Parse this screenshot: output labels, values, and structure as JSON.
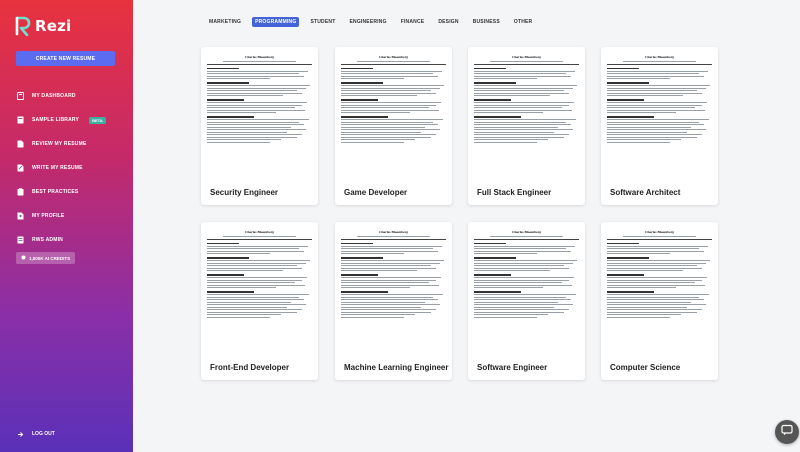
{
  "app": {
    "name": "Rezi"
  },
  "sidebar": {
    "create_button": "CREATE NEW RESUME",
    "items": [
      {
        "label": "MY DASHBOARD",
        "icon": "home-icon"
      },
      {
        "label": "SAMPLE LIBRARY",
        "icon": "book-icon",
        "badge": "BETA"
      },
      {
        "label": "REVIEW MY RESUME",
        "icon": "document-check-icon"
      },
      {
        "label": "WRITE MY RESUME",
        "icon": "pencil-icon"
      },
      {
        "label": "BEST PRACTICES",
        "icon": "clipboard-icon"
      },
      {
        "label": "MY PROFILE",
        "icon": "user-icon"
      },
      {
        "label": "RWS ADMIN",
        "icon": "admin-icon"
      }
    ],
    "credits": "1,500K AI CREDITS",
    "logout": "LOG OUT"
  },
  "filters": [
    {
      "label": "MARKETING",
      "active": false
    },
    {
      "label": "PROGRAMMING",
      "active": true
    },
    {
      "label": "STUDENT",
      "active": false
    },
    {
      "label": "ENGINEERING",
      "active": false
    },
    {
      "label": "FINANCE",
      "active": false
    },
    {
      "label": "DESIGN",
      "active": false
    },
    {
      "label": "BUSINESS",
      "active": false
    },
    {
      "label": "OTHER",
      "active": false
    }
  ],
  "cards": [
    {
      "title": "Security Engineer",
      "resume_name": "Charles Bloomberg"
    },
    {
      "title": "Game Developer",
      "resume_name": "Charles Bloomberg"
    },
    {
      "title": "Full Stack Engineer",
      "resume_name": "Charles Bloomberg"
    },
    {
      "title": "Software Architect",
      "resume_name": "Charles Bloomberg"
    },
    {
      "title": "Front-End Developer",
      "resume_name": "Charles Bloomberg"
    },
    {
      "title": "Machine Learning Engineer",
      "resume_name": "Charles Bloomberg"
    },
    {
      "title": "Software Engineer",
      "resume_name": "Charles Bloomberg"
    },
    {
      "title": "Computer Science",
      "resume_name": "Charles Bloomberg"
    }
  ],
  "colors": {
    "accent": "#4563d8",
    "create_button": "#5b6cf0",
    "beta_badge": "#3fb0a0"
  }
}
